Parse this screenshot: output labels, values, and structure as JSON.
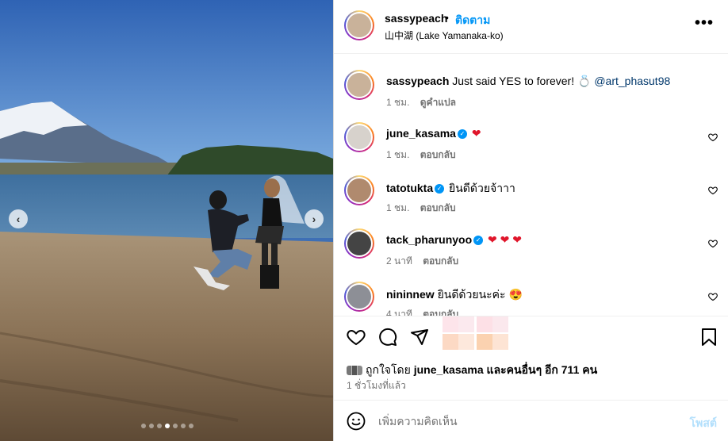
{
  "post": {
    "username": "sassypeach",
    "separator": "•",
    "follow_label": "ติดตาม",
    "location": "山中湖 (Lake Yamanaka-ko)",
    "more_icon": "more-horizontal-icon"
  },
  "caption": {
    "username": "sassypeach",
    "text": "Just said YES to forever! 💍",
    "mention": "@art_phasut98",
    "time": "1 ชม.",
    "translate_label": "ดูคำแปล"
  },
  "comments": [
    {
      "username": "june_kasama",
      "verified": true,
      "text": "❤",
      "time": "1 ชม.",
      "reply_label": "ตอบกลับ"
    },
    {
      "username": "tatotukta",
      "verified": true,
      "text": "ยินดีด้วยจ้าาา",
      "time": "1 ชม.",
      "reply_label": "ตอบกลับ"
    },
    {
      "username": "tack_pharunyoo",
      "verified": true,
      "text": "❤ ❤ ❤",
      "time": "2 นาที",
      "reply_label": "ตอบกลับ"
    },
    {
      "username": "nininnew",
      "verified": false,
      "text": "ยินดีด้วยนะค่ะ 😍",
      "time": "4 นาที",
      "reply_label": "ตอบกลับ"
    }
  ],
  "likes": {
    "prefix": "ถูกใจโดย",
    "user": "june_kasama",
    "suffix": "และคนอื่นๆ อีก 711 คน"
  },
  "timestamp": "1 ชั่วโมงที่แล้ว",
  "composer": {
    "placeholder": "เพิ่มความคิดเห็น",
    "post_label": "โพสต์"
  },
  "carousel": {
    "dot_count": 7,
    "active_index": 3
  },
  "colors": {
    "accent": "#0095f6",
    "heart": "#e0162b",
    "muted": "#737373",
    "post_disabled": "#b2dffc"
  }
}
